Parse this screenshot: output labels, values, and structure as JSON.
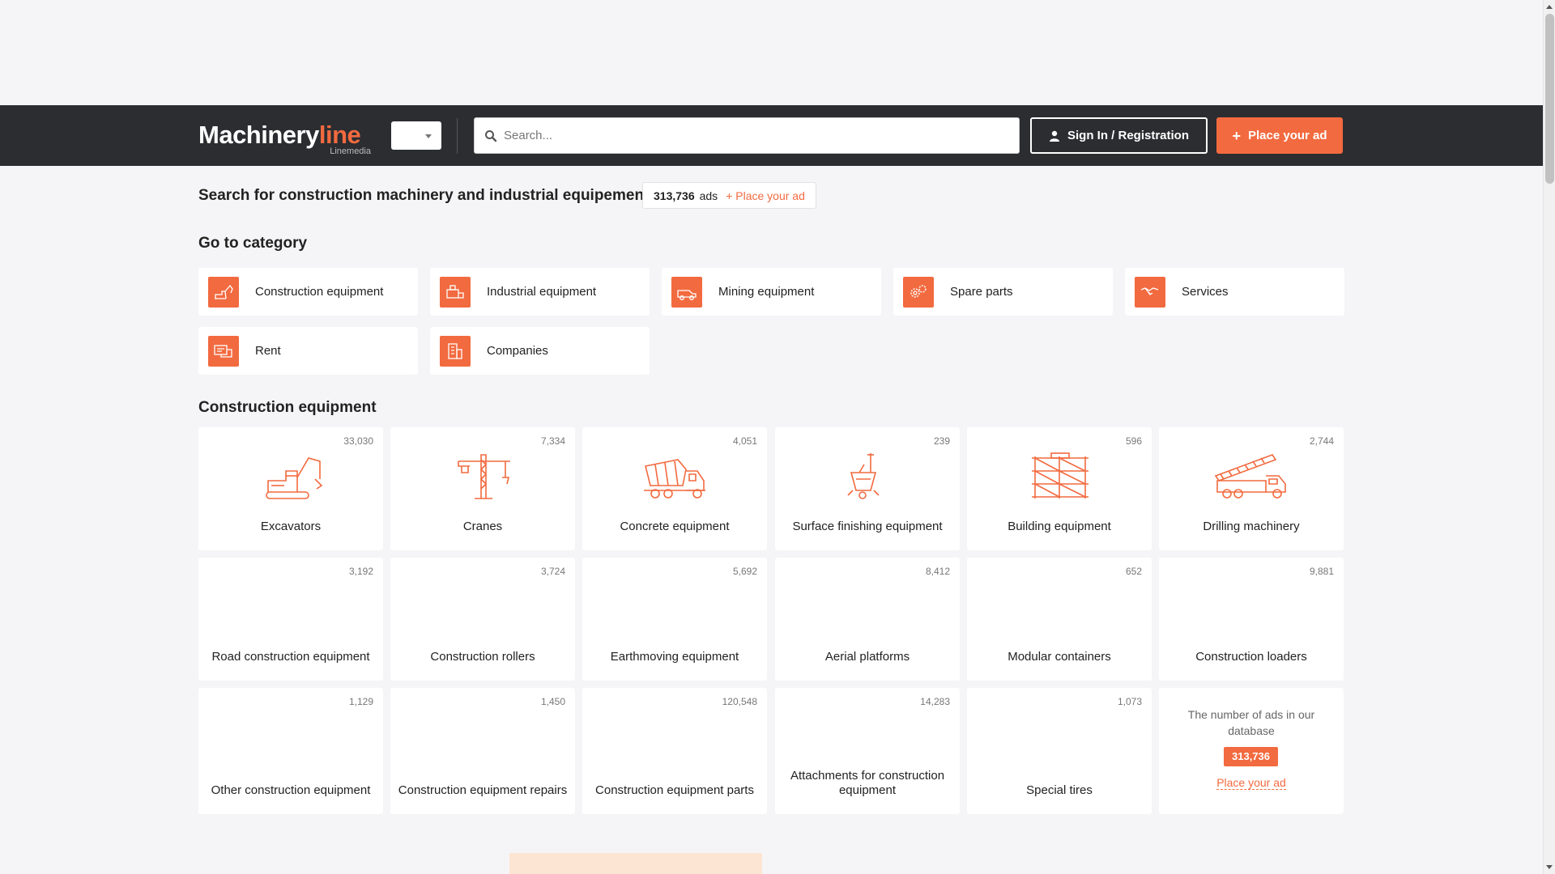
{
  "header": {
    "logo_main_a": "Machinery",
    "logo_main_b": "line",
    "logo_sub": "Linemedia",
    "search_placeholder": "Search...",
    "sign_in_label": "Sign In / Registration",
    "place_ad_label": "Place your ad"
  },
  "intro": {
    "title": "Search for construction machinery and industrial equipement",
    "ads_count": "313,736",
    "ads_word": "ads",
    "place_link": "+ Place your ad"
  },
  "go_to_category": {
    "heading": "Go to category",
    "items": [
      {
        "label": "Construction equipment",
        "icon": "excavator-icon"
      },
      {
        "label": "Industrial equipment",
        "icon": "factory-machine-icon"
      },
      {
        "label": "Mining equipment",
        "icon": "mining-truck-icon"
      },
      {
        "label": "Spare parts",
        "icon": "gears-icon"
      },
      {
        "label": "Services",
        "icon": "handshake-icon"
      },
      {
        "label": "Rent",
        "icon": "rent-machine-icon"
      },
      {
        "label": "Companies",
        "icon": "building-icon"
      }
    ]
  },
  "construction": {
    "heading": "Construction equipment",
    "tiles": [
      {
        "name": "Excavators",
        "count": "33,030",
        "icon": "excavator-icon"
      },
      {
        "name": "Cranes",
        "count": "7,334",
        "icon": "crane-icon"
      },
      {
        "name": "Concrete equipment",
        "count": "4,051",
        "icon": "concrete-mixer-icon"
      },
      {
        "name": "Surface finishing equipment",
        "count": "239",
        "icon": "floor-finisher-icon"
      },
      {
        "name": "Building equipment",
        "count": "596",
        "icon": "scaffolding-icon"
      },
      {
        "name": "Drilling machinery",
        "count": "2,744",
        "icon": "drilling-truck-icon"
      },
      {
        "name": "Road construction equipment",
        "count": "3,192"
      },
      {
        "name": "Construction rollers",
        "count": "3,724"
      },
      {
        "name": "Earthmoving equipment",
        "count": "5,692"
      },
      {
        "name": "Aerial platforms",
        "count": "8,412"
      },
      {
        "name": "Modular containers",
        "count": "652"
      },
      {
        "name": "Construction loaders",
        "count": "9,881"
      },
      {
        "name": "Other construction equipment",
        "count": "1,129"
      },
      {
        "name": "Construction equipment repairs",
        "count": "1,450"
      },
      {
        "name": "Construction equipment parts",
        "count": "120,548"
      },
      {
        "name": "Attachments for construction equipment",
        "count": "14,283"
      },
      {
        "name": "Special tires",
        "count": "1,073"
      }
    ],
    "db_box": {
      "text": "The number of ads in our database",
      "count": "313,736",
      "link": "Place your ad"
    }
  },
  "colors": {
    "accent": "#f26a3f",
    "header_bg": "#2b2d31",
    "page_bg": "#f5f5f7"
  }
}
